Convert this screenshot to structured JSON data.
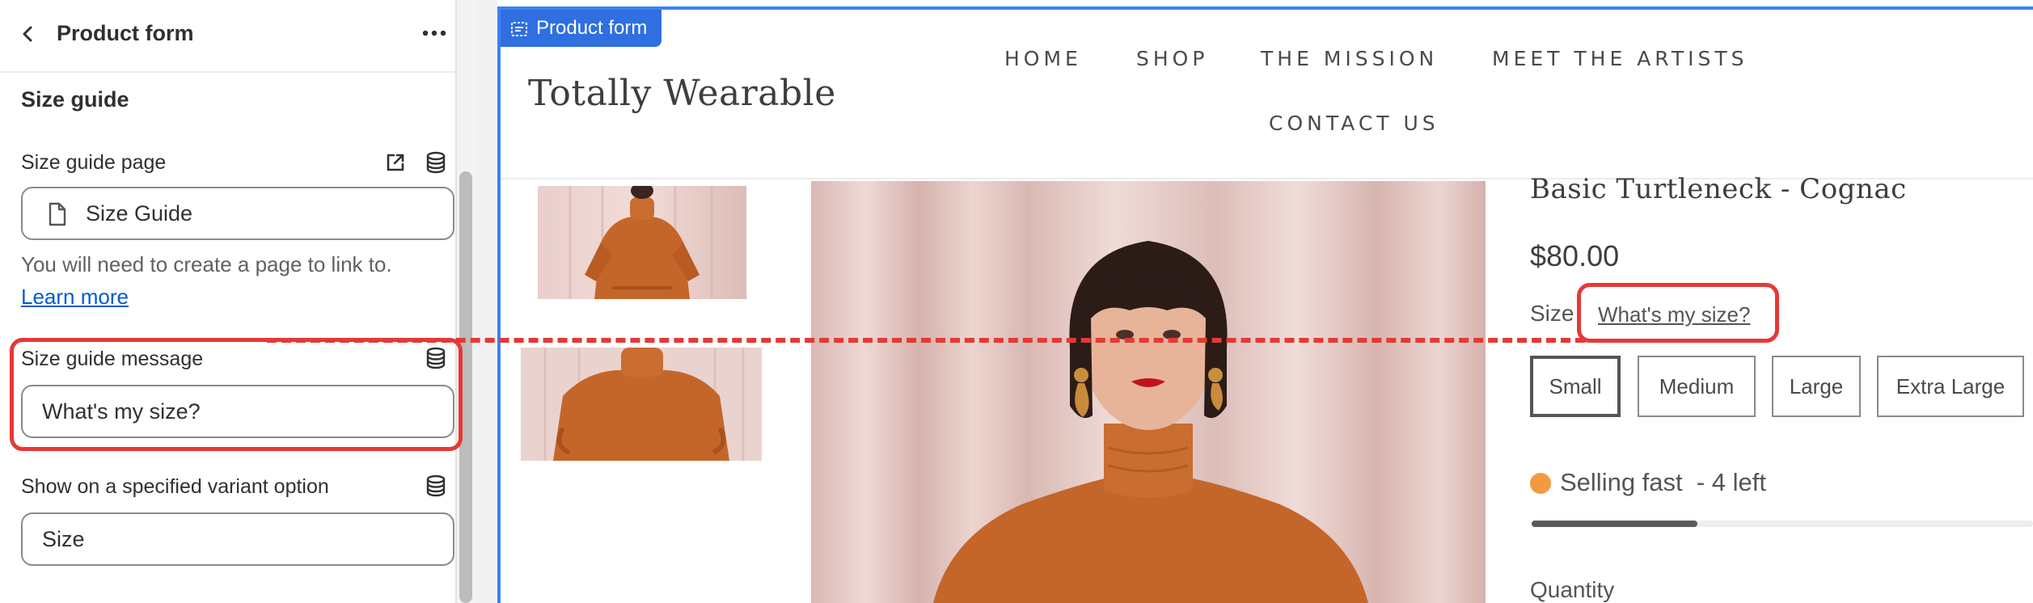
{
  "panel": {
    "title": "Product form",
    "section_heading": "Size guide",
    "size_guide_page": {
      "label": "Size guide page",
      "value": "Size Guide",
      "help": "You will need to create a page to link to.",
      "help_link": "Learn more"
    },
    "size_guide_message": {
      "label": "Size guide message",
      "value": "What's my size?"
    },
    "variant_option": {
      "label": "Show on a specified variant option",
      "value": "Size"
    }
  },
  "preview": {
    "section_tag": "Product form",
    "brand": "Totally Wearable",
    "nav": [
      "HOME",
      "SHOP",
      "THE MISSION",
      "MEET THE ARTISTS",
      "CONTACT US"
    ],
    "product": {
      "title": "Basic Turtleneck - Cognac",
      "price": "$80.00",
      "size_label": "Size",
      "size_guide_link": "What's my size?",
      "sizes": [
        "Small",
        "Medium",
        "Large",
        "Extra Large"
      ],
      "selected_size": "Small",
      "stock_text": "Selling fast  - 4 left",
      "stock_level": 0.33,
      "quantity_label": "Quantity"
    }
  },
  "colors": {
    "accent": "#2f6fe0",
    "callout": "#e53935",
    "stock_dot": "#f29a3f",
    "link": "#005bd3",
    "sweater": "#c4662a"
  }
}
